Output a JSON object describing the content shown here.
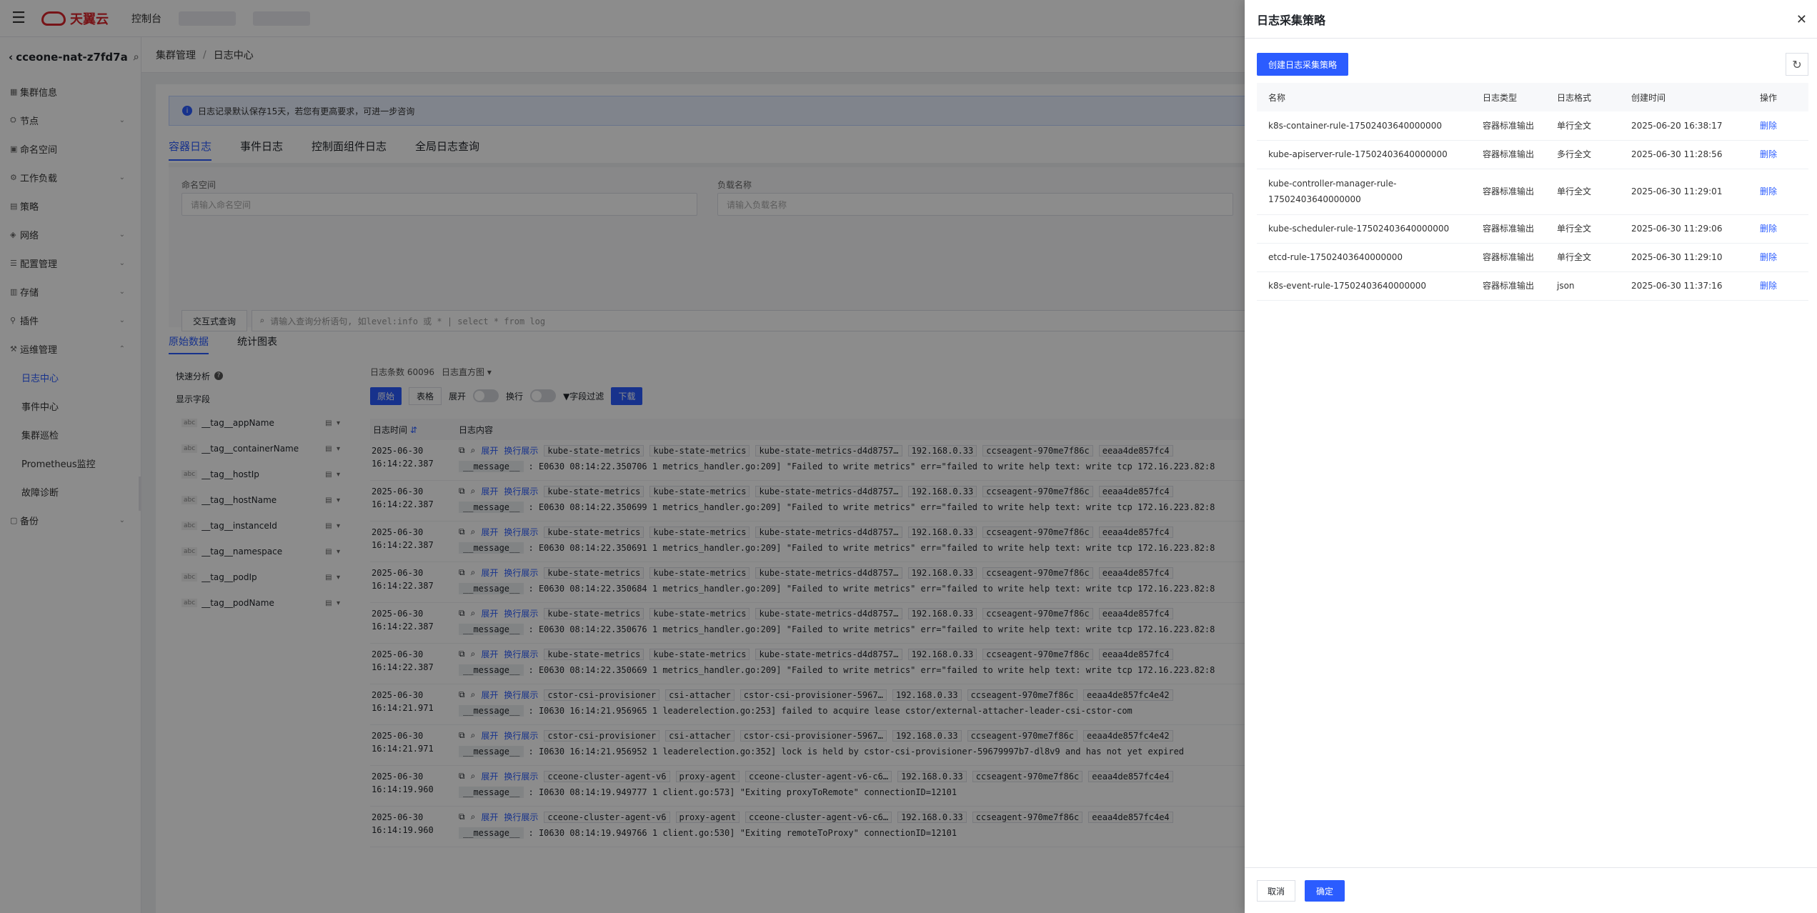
{
  "topbar": {
    "brand": "天翼云",
    "console": "控制台"
  },
  "sidebar": {
    "cluster": "cceone-nat-z7fd7a",
    "items": [
      {
        "label": "集群信息",
        "chev": false
      },
      {
        "label": "节点",
        "chev": true
      },
      {
        "label": "命名空间",
        "chev": false
      },
      {
        "label": "工作负载",
        "chev": true
      },
      {
        "label": "策略",
        "chev": false
      },
      {
        "label": "网络",
        "chev": true
      },
      {
        "label": "配置管理",
        "chev": true
      },
      {
        "label": "存储",
        "chev": true
      },
      {
        "label": "插件",
        "chev": true
      },
      {
        "label": "运维管理",
        "chev": true
      }
    ],
    "subitems": [
      "日志中心",
      "事件中心",
      "集群巡检",
      "Prometheus监控",
      "故障诊断"
    ],
    "last": "备份"
  },
  "breadcrumb": {
    "parent": "集群管理",
    "current": "日志中心"
  },
  "notice": "日志记录默认保存15天，若您有更高要求，可进一步咨询",
  "tabs": [
    "容器日志",
    "事件日志",
    "控制面组件日志",
    "全局日志查询"
  ],
  "filter": {
    "ns_label": "命名空间",
    "ns_placeholder": "请输入命名空间",
    "wl_label": "负载名称",
    "wl_placeholder": "请输入负载名称",
    "query_btn": "交互式查询",
    "query_placeholder": "请输入查询分析语句, 如level:info 或 * | select * from log"
  },
  "subtabs": [
    "原始数据",
    "统计图表"
  ],
  "fields": {
    "quick": "快速分析",
    "show": "显示字段",
    "list": [
      "__tag__appName",
      "__tag__containerName",
      "__tag__hostIp",
      "__tag__hostName",
      "__tag__instanceId",
      "__tag__namespace",
      "__tag__podIp",
      "__tag__podName"
    ]
  },
  "logs": {
    "count": "日志条数 60096",
    "histogram": "日志直方图",
    "raw": "原始",
    "table": "表格",
    "expand": "展开",
    "wrap": "换行",
    "field_filter": "字段过滤",
    "download": "下载",
    "col_time": "日志时间",
    "col_content": "日志内容",
    "expand_link": "展开",
    "wrap_link": "换行展示",
    "msg_key": "__message__",
    "rows": [
      {
        "date": "2025-06-30",
        "time": "16:14:22.387",
        "tags": [
          "kube-state-metrics",
          "kube-state-metrics",
          "kube-state-metrics-d4d8757…",
          "192.168.0.33",
          "ccseagent-970me7f86c",
          "eeaa4de857fc4"
        ],
        "msg": "E0630 08:14:22.350706       1 metrics_handler.go:209] \"Failed to write metrics\" err=\"failed to write help text: write tcp 172.16.223.82:8"
      },
      {
        "date": "2025-06-30",
        "time": "16:14:22.387",
        "tags": [
          "kube-state-metrics",
          "kube-state-metrics",
          "kube-state-metrics-d4d8757…",
          "192.168.0.33",
          "ccseagent-970me7f86c",
          "eeaa4de857fc4"
        ],
        "msg": "E0630 08:14:22.350699       1 metrics_handler.go:209] \"Failed to write metrics\" err=\"failed to write help text: write tcp 172.16.223.82:8"
      },
      {
        "date": "2025-06-30",
        "time": "16:14:22.387",
        "tags": [
          "kube-state-metrics",
          "kube-state-metrics",
          "kube-state-metrics-d4d8757…",
          "192.168.0.33",
          "ccseagent-970me7f86c",
          "eeaa4de857fc4"
        ],
        "msg": "E0630 08:14:22.350691       1 metrics_handler.go:209] \"Failed to write metrics\" err=\"failed to write help text: write tcp 172.16.223.82:8"
      },
      {
        "date": "2025-06-30",
        "time": "16:14:22.387",
        "tags": [
          "kube-state-metrics",
          "kube-state-metrics",
          "kube-state-metrics-d4d8757…",
          "192.168.0.33",
          "ccseagent-970me7f86c",
          "eeaa4de857fc4"
        ],
        "msg": "E0630 08:14:22.350684       1 metrics_handler.go:209] \"Failed to write metrics\" err=\"failed to write help text: write tcp 172.16.223.82:8"
      },
      {
        "date": "2025-06-30",
        "time": "16:14:22.387",
        "tags": [
          "kube-state-metrics",
          "kube-state-metrics",
          "kube-state-metrics-d4d8757…",
          "192.168.0.33",
          "ccseagent-970me7f86c",
          "eeaa4de857fc4"
        ],
        "msg": "E0630 08:14:22.350676       1 metrics_handler.go:209] \"Failed to write metrics\" err=\"failed to write help text: write tcp 172.16.223.82:8"
      },
      {
        "date": "2025-06-30",
        "time": "16:14:22.387",
        "tags": [
          "kube-state-metrics",
          "kube-state-metrics",
          "kube-state-metrics-d4d8757…",
          "192.168.0.33",
          "ccseagent-970me7f86c",
          "eeaa4de857fc4"
        ],
        "msg": "E0630 08:14:22.350669       1 metrics_handler.go:209] \"Failed to write metrics\" err=\"failed to write help text: write tcp 172.16.223.82:8"
      },
      {
        "date": "2025-06-30",
        "time": "16:14:21.971",
        "tags": [
          "cstor-csi-provisioner",
          "csi-attacher",
          "cstor-csi-provisioner-5967…",
          "192.168.0.33",
          "ccseagent-970me7f86c",
          "eeaa4de857fc4e42"
        ],
        "msg": "I0630 16:14:21.956965       1 leaderelection.go:253] failed to acquire lease cstor/external-attacher-leader-csi-cstor-com"
      },
      {
        "date": "2025-06-30",
        "time": "16:14:21.971",
        "tags": [
          "cstor-csi-provisioner",
          "csi-attacher",
          "cstor-csi-provisioner-5967…",
          "192.168.0.33",
          "ccseagent-970me7f86c",
          "eeaa4de857fc4e42"
        ],
        "msg": "I0630 16:14:21.956952       1 leaderelection.go:352] lock is held by cstor-csi-provisioner-59679997b7-dl8v9 and has not yet expired"
      },
      {
        "date": "2025-06-30",
        "time": "16:14:19.960",
        "tags": [
          "cceone-cluster-agent-v6",
          "proxy-agent",
          "cceone-cluster-agent-v6-c6…",
          "192.168.0.33",
          "ccseagent-970me7f86c",
          "eeaa4de857fc4e4"
        ],
        "msg": "I0630 08:14:19.949777       1 client.go:573] \"Exiting proxyToRemote\" connectionID=12101"
      },
      {
        "date": "2025-06-30",
        "time": "16:14:19.960",
        "tags": [
          "cceone-cluster-agent-v6",
          "proxy-agent",
          "cceone-cluster-agent-v6-c6…",
          "192.168.0.33",
          "ccseagent-970me7f86c",
          "eeaa4de857fc4e4"
        ],
        "msg": "I0630 08:14:19.949766       1 client.go:530] \"Exiting remoteToProxy\" connectionID=12101"
      }
    ]
  },
  "drawer": {
    "title": "日志采集策略",
    "create": "创建日志采集策略",
    "columns": [
      "名称",
      "日志类型",
      "日志格式",
      "创建时间",
      "操作"
    ],
    "rows": [
      {
        "name": "k8s-container-rule-17502403640000000",
        "type": "容器标准输出",
        "format": "单行全文",
        "time": "2025-06-20 16:38:17",
        "op": "删除"
      },
      {
        "name": "kube-apiserver-rule-17502403640000000",
        "type": "容器标准输出",
        "format": "多行全文",
        "time": "2025-06-30 11:28:56",
        "op": "删除"
      },
      {
        "name": "kube-controller-manager-rule-\n17502403640000000",
        "type": "容器标准输出",
        "format": "单行全文",
        "time": "2025-06-30 11:29:01",
        "op": "删除"
      },
      {
        "name": "kube-scheduler-rule-17502403640000000",
        "type": "容器标准输出",
        "format": "单行全文",
        "time": "2025-06-30 11:29:06",
        "op": "删除"
      },
      {
        "name": "etcd-rule-17502403640000000",
        "type": "容器标准输出",
        "format": "单行全文",
        "time": "2025-06-30 11:29:10",
        "op": "删除"
      },
      {
        "name": "k8s-event-rule-17502403640000000",
        "type": "容器标准输出",
        "format": "json",
        "time": "2025-06-30 11:37:16",
        "op": "删除"
      }
    ],
    "cancel": "取消",
    "ok": "确定"
  }
}
